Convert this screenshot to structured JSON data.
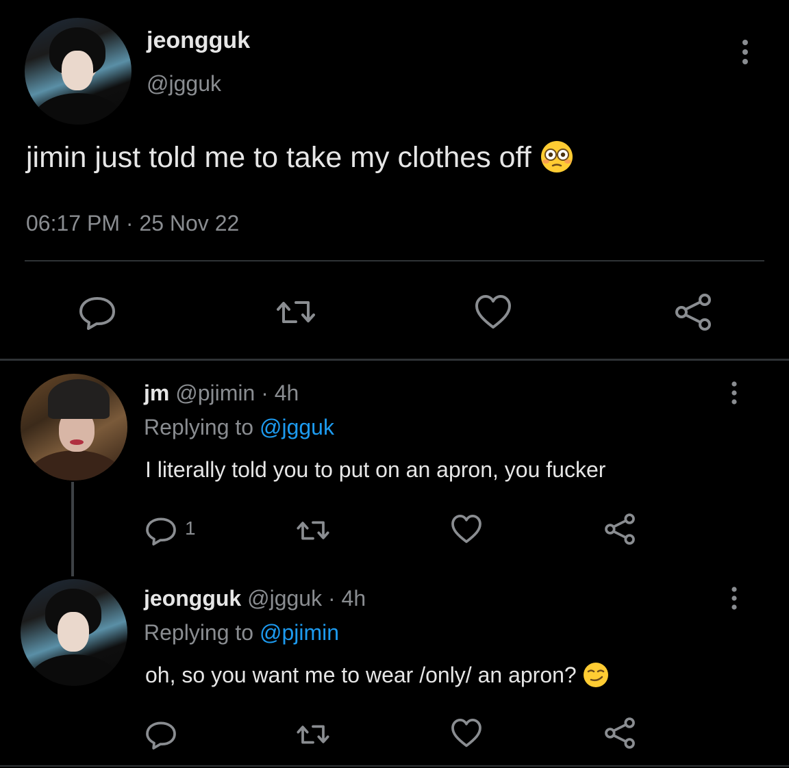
{
  "main_tweet": {
    "name": "jeongguk",
    "handle": "@jgguk",
    "text": "jimin just told me to take my clothes off",
    "emoji": "flushed-face-emoji",
    "time": "06:17 PM",
    "separator": "·",
    "date": "25 Nov 22",
    "actions": [
      "reply-icon",
      "retweet-icon",
      "like-icon",
      "share-icon"
    ]
  },
  "replies": [
    {
      "name": "jm",
      "handle": "@pjimin",
      "separator": "·",
      "age": "4h",
      "replying_prefix": "Replying to",
      "replying_to": "@jgguk",
      "text": "I literally told you to put on an apron, you fucker",
      "reply_count": "1"
    },
    {
      "name": "jeongguk",
      "handle": "@jgguk",
      "separator": "·",
      "age": "4h",
      "replying_prefix": "Replying to",
      "replying_to": "@pjimin",
      "text": "oh, so you want me to wear /only/ an apron?",
      "emoji": "smirking-face-emoji"
    }
  ],
  "colors": {
    "background": "#000000",
    "text_primary": "#e6e6e6",
    "text_secondary": "#8a8d91",
    "link": "#1d9bf0",
    "divider": "#2f3336"
  }
}
